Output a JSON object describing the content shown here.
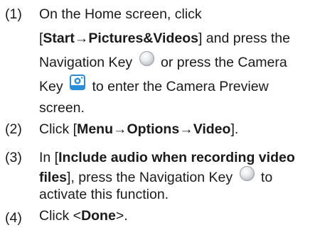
{
  "steps": [
    {
      "number": "(1)",
      "lines": [
        {
          "text": "On the Home screen, click"
        },
        {
          "pre": "[",
          "b1": "Start→Pictures&Videos",
          "post": "] and press the"
        },
        {
          "text": "Navigation Key",
          "tail": "or press the Camera"
        },
        {
          "text": "Key",
          "tail": "to enter the Camera Preview"
        },
        {
          "text": "screen."
        }
      ]
    },
    {
      "number": "(2)",
      "pre": "Click [",
      "b1": "Menu",
      "sep1": "→",
      "b2": "Options",
      "sep2": "→",
      "b3": "Video",
      "post": "]."
    },
    {
      "number": "(3)",
      "l1_pre": "In [",
      "l1_bold": "Include audio when recording video",
      "l2_bold": "files",
      "l2_mid": "], press the Navigation Key",
      "l2_tail": "to",
      "l3": "activate this function."
    },
    {
      "number": "(4)",
      "pre": "Click <",
      "bold": "Done",
      "post": ">."
    }
  ],
  "icons": {
    "navigation_key": "navigation-key-icon",
    "camera_key": "camera-key-icon"
  },
  "colors": {
    "text": "#1a1a1a",
    "camera_key_blue": "#2a8fd8"
  }
}
